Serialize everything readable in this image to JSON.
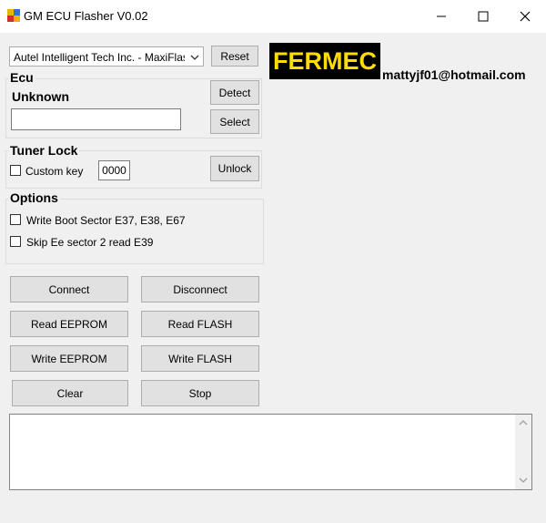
{
  "window": {
    "title": "GM ECU Flasher V0.02",
    "minimize_icon": "minimize-icon",
    "maximize_icon": "maximize-icon",
    "close_icon": "close-icon"
  },
  "device": {
    "selected": "Autel Intelligent Tech Inc. - MaxiFlash Bl",
    "reset_label": "Reset"
  },
  "ecu": {
    "group_label": "Ecu",
    "status": "Unknown",
    "field_value": "",
    "detect_label": "Detect",
    "select_label": "Select"
  },
  "tuner_lock": {
    "group_label": "Tuner Lock",
    "custom_key_label": "Custom key",
    "key_value": "0000",
    "unlock_label": "Unlock"
  },
  "options": {
    "group_label": "Options",
    "write_boot_label": "Write Boot Sector E37, E38, E67",
    "skip_ee_label": "Skip Ee sector 2 read E39"
  },
  "actions": {
    "connect": "Connect",
    "disconnect": "Disconnect",
    "read_eeprom": "Read  EEPROM",
    "read_flash": "Read  FLASH",
    "write_eeprom": "Write  EEPROM",
    "write_flash": "Write  FLASH",
    "clear": "Clear",
    "stop": "Stop"
  },
  "branding": {
    "logo_text": "FERMEC",
    "email": "mattyjf01@hotmail.com",
    "logo_bg": "#000000",
    "logo_fg": "#ffdd00"
  },
  "log": {
    "text": ""
  }
}
